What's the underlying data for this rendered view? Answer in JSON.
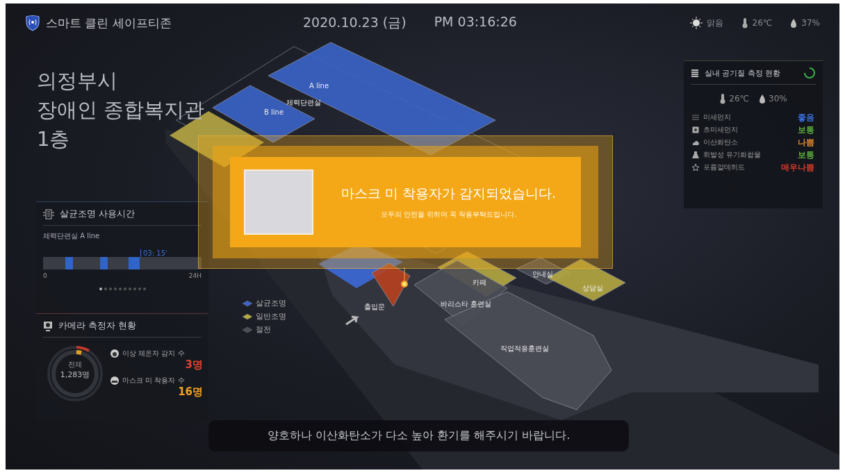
{
  "header": {
    "app_name": "스마트 클린 세이프티존",
    "date": "2020.10.23 (금)",
    "time": "PM 03:16:26",
    "weather": {
      "condition": "맑음",
      "temperature": "26℃",
      "humidity": "37%"
    }
  },
  "location": {
    "lines": [
      "의정부시",
      "장애인 종합복지관",
      "1층"
    ]
  },
  "lighting_panel": {
    "title": "살균조명 사용시간",
    "room": "체력단련실 A line",
    "current_time": "03: 15'",
    "axis_start": "0",
    "axis_end": "24H",
    "pages": [
      {
        "selected": true
      },
      {
        "selected": false
      },
      {
        "selected": false
      },
      {
        "selected": false
      },
      {
        "selected": false
      },
      {
        "selected": false
      },
      {
        "selected": false
      },
      {
        "selected": false
      },
      {
        "selected": false
      },
      {
        "selected": false
      }
    ]
  },
  "camera_panel": {
    "title": "카메라 측정자 현황",
    "total_label": "전체",
    "total": "1,283명",
    "stats": [
      {
        "kind": "fever",
        "label": "이상 체온자 감지 수",
        "value": "3명",
        "color": "#e0432f"
      },
      {
        "kind": "mask",
        "label": "마스크 미 착용자 수",
        "value": "16명",
        "color": "#f0a020"
      }
    ]
  },
  "air_panel": {
    "title": "실내 공기질 측정 현황",
    "temperature": "26℃",
    "humidity": "30%",
    "items": [
      {
        "kind": "dust",
        "name": "미세먼지",
        "grade": "좋음",
        "color": "#3a6fd8"
      },
      {
        "kind": "fine-dust",
        "name": "초미세먼지",
        "grade": "보통",
        "color": "#5cae3c"
      },
      {
        "kind": "co2",
        "name": "이산화탄소",
        "grade": "나쁨",
        "color": "#e08a2a"
      },
      {
        "kind": "voc",
        "name": "휘발성 유기화합물",
        "grade": "보통",
        "color": "#5cae3c"
      },
      {
        "kind": "formaldehyde",
        "name": "포름알데히드",
        "grade": "매우나쁨",
        "color": "#d83a2a"
      }
    ]
  },
  "map": {
    "area_label": "체력단련실",
    "rooms": [
      {
        "label": "A line",
        "kind": "sterilizing"
      },
      {
        "label": "B line",
        "kind": "sterilizing"
      },
      {
        "label": "안내실",
        "kind": "off"
      },
      {
        "label": "카페",
        "kind": "general"
      },
      {
        "label": "상담실",
        "kind": "general"
      },
      {
        "label": "바리스타 훈련실",
        "kind": "off"
      },
      {
        "label": "직업적응훈련실",
        "kind": "off"
      },
      {
        "label": "출입문",
        "kind": "entrance"
      }
    ],
    "legend": [
      {
        "kind": "sterilizing",
        "label": "살균조명"
      },
      {
        "kind": "general",
        "label": "일반조명"
      },
      {
        "kind": "off",
        "label": "절전"
      }
    ]
  },
  "alert": {
    "title": "마스크 미 착용자가 감지되었습니다.",
    "message": "모두의 안전을 위하여 꼭 착용부탁드립니다."
  },
  "notice": "양호하나 이산화탄소가 다소 높아 환기를 해주시기 바랍니다."
}
